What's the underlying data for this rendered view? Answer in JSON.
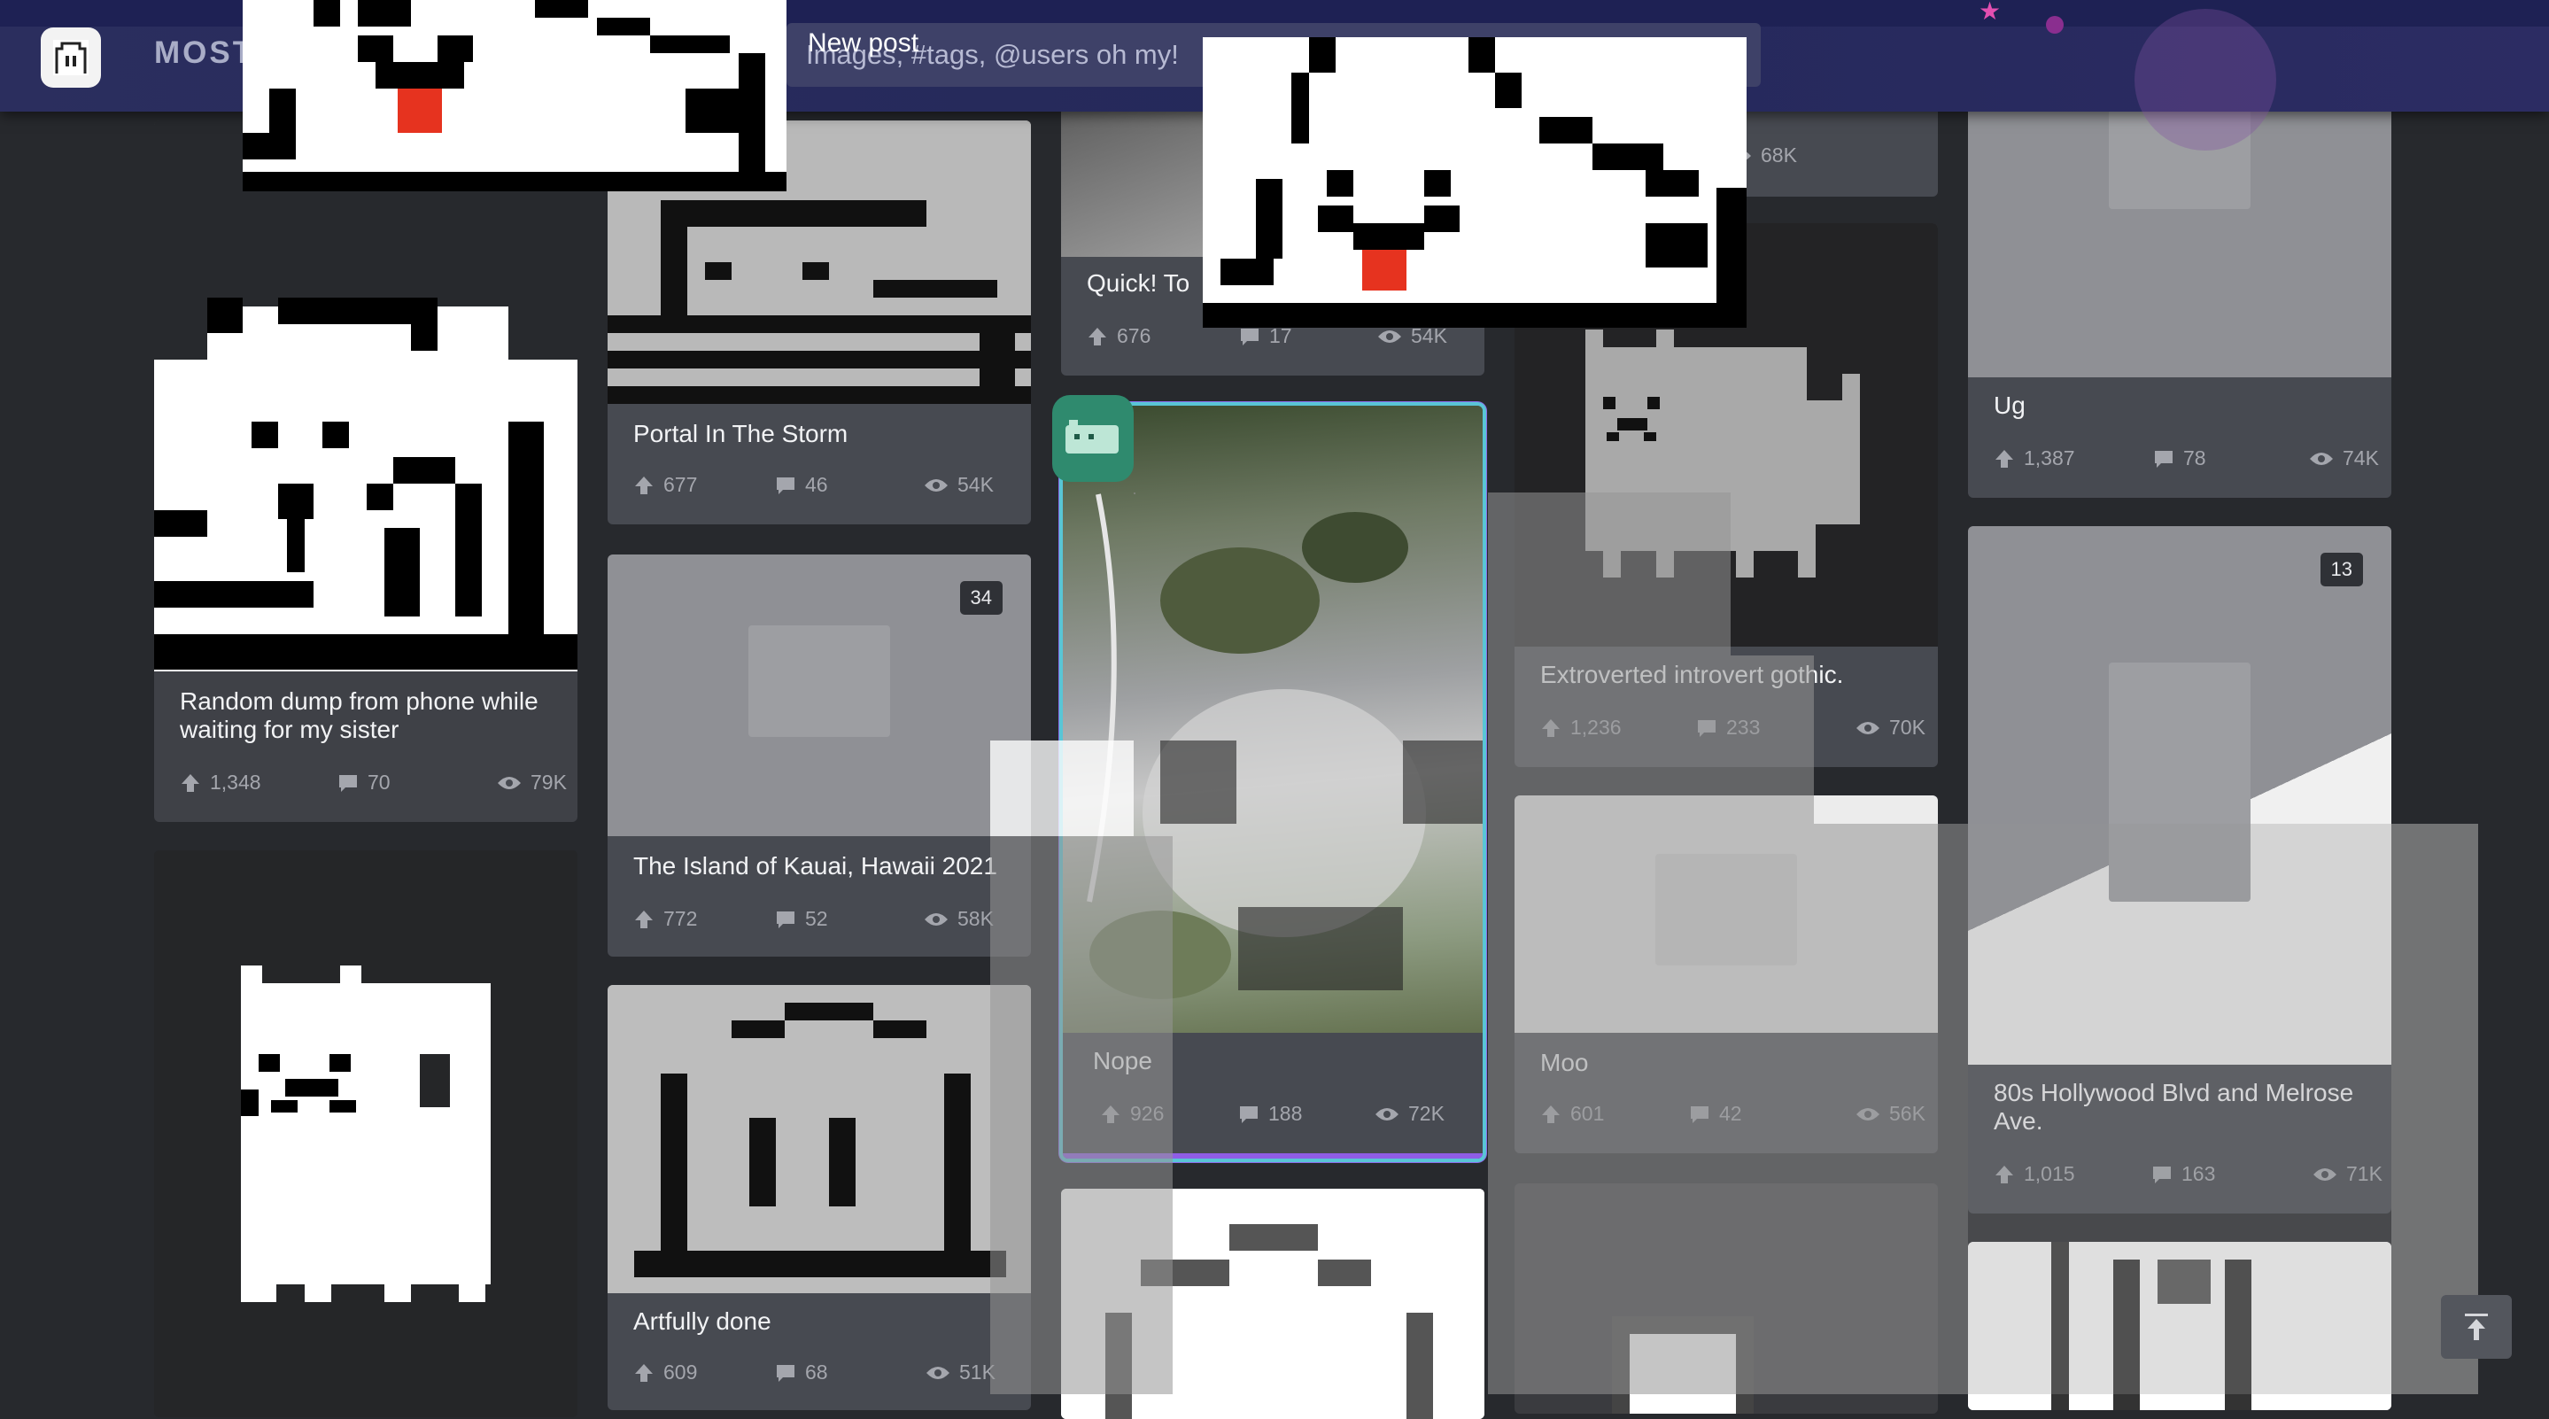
{
  "header": {
    "brand": "MOST",
    "search_placeholder": "Images, #tags, @users oh my!",
    "new_post_label": "New post"
  },
  "colors": {
    "background": "#27292d",
    "header": "#24285a",
    "card": "#474a51",
    "accent_border": "#59c5d6",
    "accent_purple": "#8f5de6",
    "stat_text": "#a4a6ad"
  },
  "icons": {
    "upvote": "arrow-up-icon",
    "comments": "comment-icon",
    "views": "eye-icon",
    "scroll_top": "arrow-to-top-icon",
    "placeholder": "image-placeholder-icon"
  },
  "posts": {
    "c1": {
      "title": "Random dump from phone while waiting for my sister",
      "up": "1,348",
      "comments": "70",
      "views": "79K"
    },
    "c2": {
      "title": "Portal In The Storm",
      "up": "677",
      "comments": "46",
      "views": "54K"
    },
    "c3": {
      "title": "The Island of Kauai, Hawaii 2021",
      "up": "772",
      "comments": "52",
      "views": "58K",
      "badge": "34"
    },
    "c4": {
      "title": "Artfully done",
      "up": "609",
      "comments": "68",
      "views": "51K"
    },
    "c5": {
      "title": "Quick!  To",
      "up": "676",
      "comments": "17",
      "views": "54K"
    },
    "c6": {
      "title": "Nope",
      "up": "926",
      "comments": "188",
      "views": "72K"
    },
    "c7": {
      "views": "68K"
    },
    "c8": {
      "title": "Extroverted introvert gothic.",
      "up": "1,236",
      "comments": "233",
      "views": "70K"
    },
    "c9": {
      "title": "Moo",
      "up": "601",
      "comments": "42",
      "views": "56K"
    },
    "c10": {
      "title": "Ug",
      "up": "1,387",
      "comments": "78",
      "views": "74K"
    },
    "c11": {
      "title": "80s Hollywood Blvd and Melrose Ave.",
      "up": "1,015",
      "comments": "163",
      "views": "71K",
      "badge": "13"
    }
  }
}
